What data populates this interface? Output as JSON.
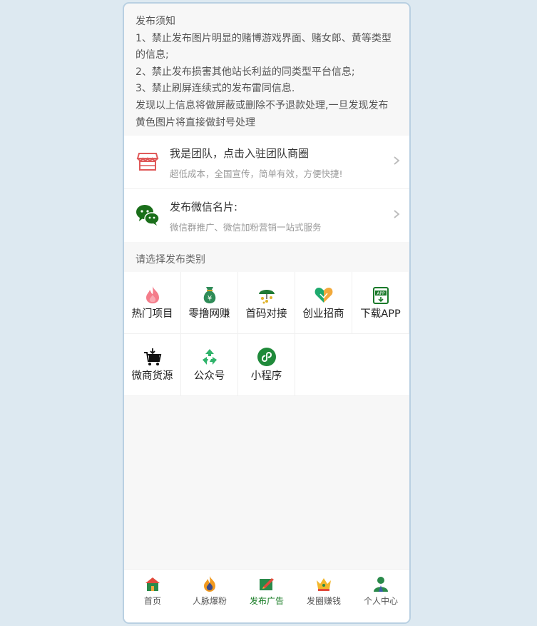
{
  "notice": {
    "title": "发布须知",
    "lines": [
      "1、禁止发布图片明显的赌博游戏界面、赌女郎、黄等类型的信息;",
      "2、禁止发布损害其他站长利益的同类型平台信息;",
      "3、禁止刷屏连续式的发布雷同信息.",
      "发现以上信息将做屏蔽或删除不予退款处理,一旦发现发布黄色图片将直接做封号处理"
    ]
  },
  "cards": [
    {
      "icon": "storefront-icon",
      "title": "我是团队，点击入驻团队商圈",
      "subtitle": "超低成本，全国宣传，简单有效，方便快捷!"
    },
    {
      "icon": "wechat-icon",
      "title": "发布微信名片:",
      "subtitle": "微信群推广、微信加粉营销一站式服务"
    }
  ],
  "category_label": "请选择发布类别",
  "categories": [
    {
      "label": "热门项目",
      "icon": "flame-icon"
    },
    {
      "label": "零撸网赚",
      "icon": "money-bag-icon"
    },
    {
      "label": "首码对接",
      "icon": "money-umbrella-icon"
    },
    {
      "label": "创业招商",
      "icon": "handshake-heart-icon"
    },
    {
      "label": "下载APP",
      "icon": "app-download-icon"
    },
    {
      "label": "微商货源",
      "icon": "shopping-cart-icon"
    },
    {
      "label": "公众号",
      "icon": "recycle-icon"
    },
    {
      "label": "小程序",
      "icon": "mini-program-icon"
    }
  ],
  "tabbar": [
    {
      "label": "首页",
      "icon": "home-icon",
      "active": false
    },
    {
      "label": "人脉爆粉",
      "icon": "fire-icon",
      "active": false
    },
    {
      "label": "发布广告",
      "icon": "publish-icon",
      "active": true
    },
    {
      "label": "发圈赚钱",
      "icon": "crown-icon",
      "active": false
    },
    {
      "label": "个人中心",
      "icon": "user-icon",
      "active": false
    }
  ],
  "colors": {
    "accent": "#157a22",
    "background": "#dde9f1",
    "panel": "#f7f7f7"
  }
}
